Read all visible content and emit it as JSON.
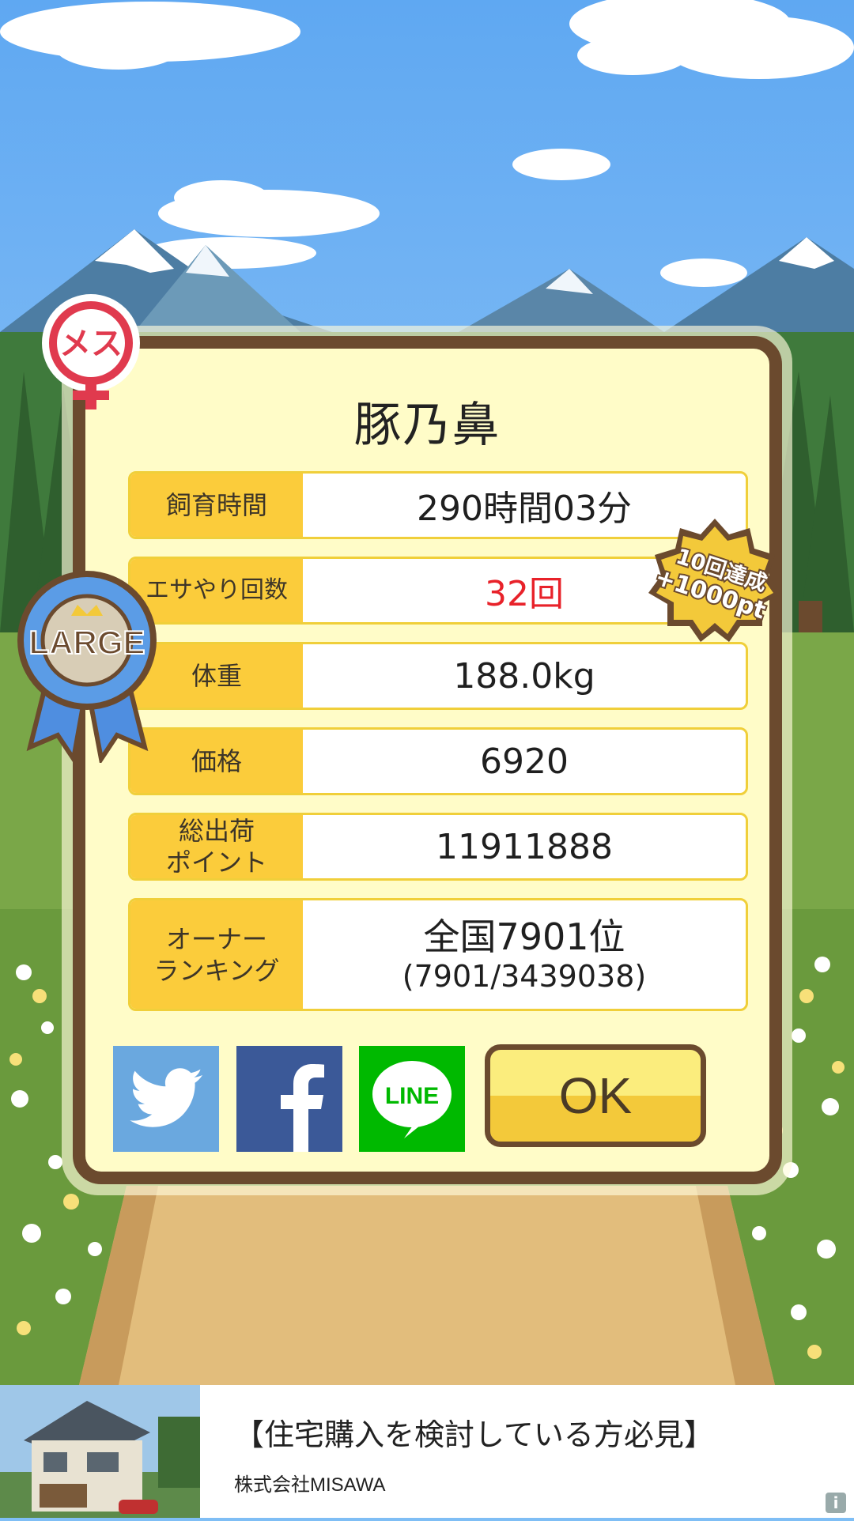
{
  "colors": {
    "dialog_bg": "#fffcc8",
    "dialog_border": "#6b4a2e",
    "label_bg": "#fbcc3b",
    "highlight_red": "#e8222a",
    "twitter": "#6aa8df",
    "facebook": "#3b5998",
    "line": "#00b900",
    "ok_button": "#f3c93a"
  },
  "badges": {
    "gender_label": "メス",
    "size_label": "LARGE",
    "achievement_line1": "10回達成",
    "achievement_line2": "+1000pt"
  },
  "dialog": {
    "pig_name": "豚乃鼻",
    "rows": [
      {
        "label": "飼育時間",
        "value": "290時間03分"
      },
      {
        "label": "エサやり回数",
        "value": "32回"
      },
      {
        "label": "体重",
        "value": "188.0kg"
      },
      {
        "label": "価格",
        "value": "6920"
      },
      {
        "label_line1": "総出荷",
        "label_line2": "ポイント",
        "value": "11911888"
      },
      {
        "label_line1": "オーナー",
        "label_line2": "ランキング",
        "value_main": "全国7901位",
        "value_sub": "(7901/3439038)"
      }
    ],
    "share_buttons": {
      "twitter_icon": "twitter-bird-icon",
      "facebook_icon": "facebook-f-icon",
      "line_label": "LINE"
    },
    "ok_label": "OK"
  },
  "ad": {
    "title": "【住宅購入を検討している方必見】",
    "company": "株式会社MISAWA",
    "info_icon": "i"
  }
}
